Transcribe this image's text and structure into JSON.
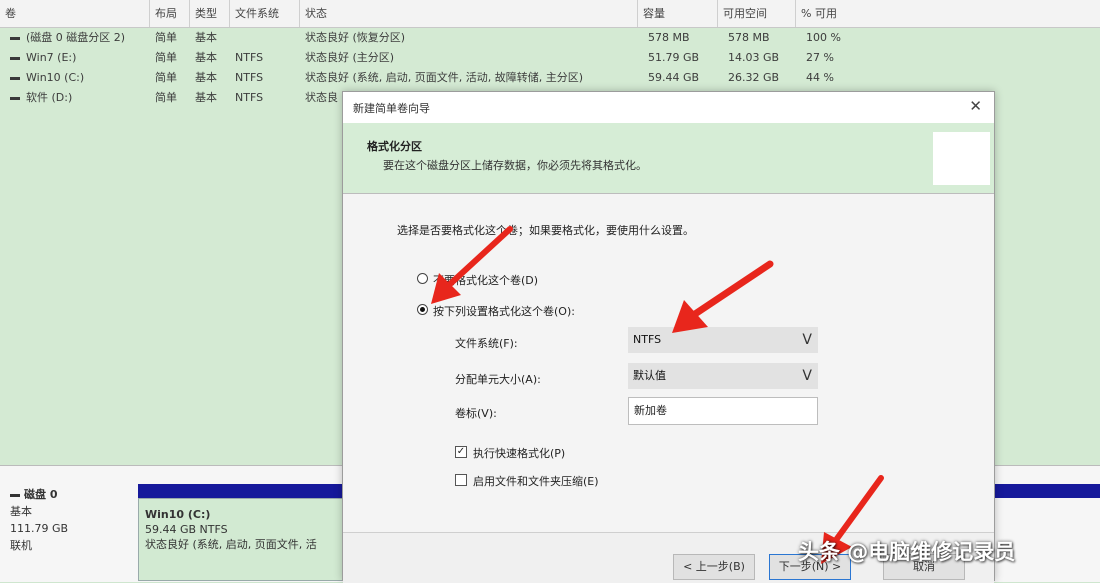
{
  "table": {
    "columns": [
      "卷",
      "布局",
      "类型",
      "文件系统",
      "状态",
      "容量",
      "可用空间",
      "% 可用"
    ],
    "rows": [
      {
        "name": "(磁盘 0 磁盘分区 2)",
        "layout": "简单",
        "type": "基本",
        "fs": "",
        "status": "状态良好 (恢复分区)",
        "capacity": "578 MB",
        "free": "578 MB",
        "pct": "100 %"
      },
      {
        "name": "Win7 (E:)",
        "layout": "简单",
        "type": "基本",
        "fs": "NTFS",
        "status": "状态良好 (主分区)",
        "capacity": "51.79 GB",
        "free": "14.03 GB",
        "pct": "27 %"
      },
      {
        "name": "Win10 (C:)",
        "layout": "简单",
        "type": "基本",
        "fs": "NTFS",
        "status": "状态良好 (系统, 启动, 页面文件, 活动, 故障转储, 主分区)",
        "capacity": "59.44 GB",
        "free": "26.32 GB",
        "pct": "44 %"
      },
      {
        "name": "软件 (D:)",
        "layout": "简单",
        "type": "基本",
        "fs": "NTFS",
        "status": "状态良",
        "capacity": "",
        "free": "",
        "pct": ""
      }
    ]
  },
  "disk": {
    "name": "磁盘 0",
    "type": "基本",
    "size": "111.79 GB",
    "state": "联机",
    "partition": {
      "name": "Win10 (C:)",
      "size_fs": "59.44 GB NTFS",
      "status": "状态良好 (系统, 启动, 页面文件, 活"
    }
  },
  "dialog": {
    "title": "新建简单卷向导",
    "close": "✕",
    "banner_title": "格式化分区",
    "banner_subtitle": "要在这个磁盘分区上储存数据，你必须先将其格式化。",
    "prompt": "选择是否要格式化这个卷；如果要格式化，要使用什么设置。",
    "option_no_format": "不要格式化这个卷(D)",
    "option_format": "按下列设置格式化这个卷(O):",
    "selected_option": "format",
    "fs_label": "文件系统(F):",
    "fs_value": "NTFS",
    "alloc_label": "分配单元大小(A):",
    "alloc_value": "默认值",
    "volume_label_label": "卷标(V):",
    "volume_label_value": "新加卷",
    "quick_format_label": "执行快速格式化(P)",
    "quick_format_checked": true,
    "compress_label": "启用文件和文件夹压缩(E)",
    "compress_checked": false,
    "dropdown_glyph": "V",
    "back_button": "< 上一步(B)",
    "next_button": "下一步(N) >",
    "cancel_button": "取消"
  },
  "watermark": "头条 @电脑维修记录员",
  "colors": {
    "volume_bg": "#d4ead3",
    "partition_bar": "#16199b",
    "annotation_arrow": "#e8261c",
    "banner_bg": "#d6edd6"
  }
}
